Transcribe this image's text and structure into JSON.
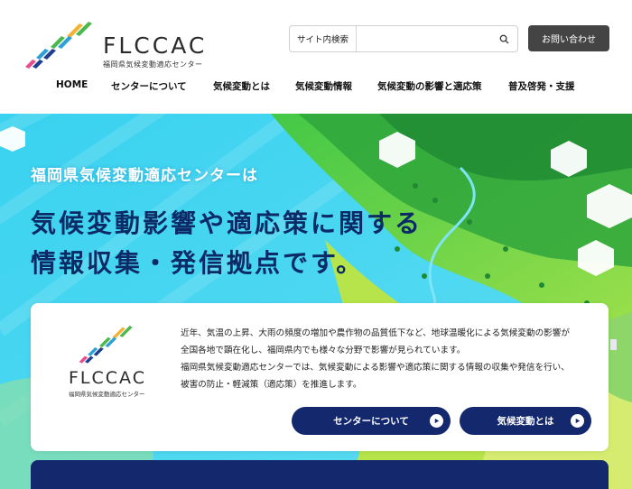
{
  "header": {
    "logo_text": "FLCCAC",
    "logo_sub": "福岡県気候変動適応センター",
    "search_label": "サイト内検索",
    "search_placeholder": "",
    "search_icon": "magnifier-icon",
    "contact_label": "お問い合わせ"
  },
  "nav": {
    "items": [
      {
        "label": "HOME"
      },
      {
        "label": "センターについて"
      },
      {
        "label": "気候変動とは"
      },
      {
        "label": "気候変動情報"
      },
      {
        "label": "気候変動の影響と適応策"
      },
      {
        "label": "普及啓発・支援"
      }
    ]
  },
  "hero": {
    "subtitle": "福岡県気候変動適応センターは",
    "headline_1": "気候変動影響や適応策に関する",
    "headline_2": "情報収集・発信拠点です。"
  },
  "card": {
    "logo_text": "FLCCAC",
    "logo_sub": "福岡県気候変動適応センター",
    "paragraph_lines": [
      "近年、気温の上昇、大雨の頻度の増加や農作物の品質低下など、地球温暖化による気候変動の影響が",
      "全国各地で顕在化し、福岡県内でも様々な分野で影響が見られています。",
      "福岡県気候変動適応センターでは、気候変動による影響や適応策に関する情報の収集や発信を行い、",
      "被害の防止・軽減策（適応策）を推進します。"
    ],
    "button_about": "センターについて",
    "button_climate": "気候変動とは"
  },
  "colors": {
    "navy": "#14286e",
    "contact_bg": "#444444",
    "hero_cyan": "#35d0ee",
    "hero_green": "#4cc84a",
    "logo_colors": [
      "#f3b234",
      "#4bb84e",
      "#2f9fd8",
      "#1e3f8f",
      "#e84c8a"
    ]
  }
}
